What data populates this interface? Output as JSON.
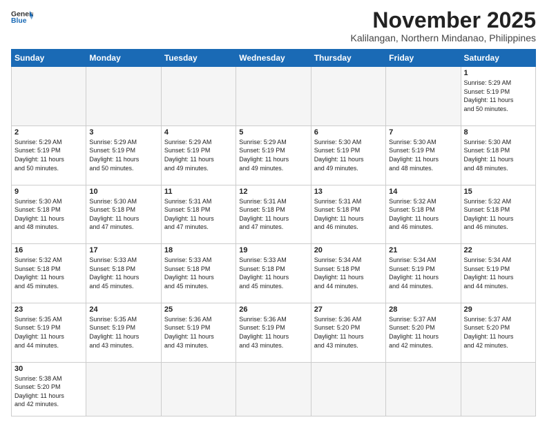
{
  "header": {
    "logo_line1": "General",
    "logo_line2": "Blue",
    "month": "November 2025",
    "location": "Kalilangan, Northern Mindanao, Philippines"
  },
  "days_of_week": [
    "Sunday",
    "Monday",
    "Tuesday",
    "Wednesday",
    "Thursday",
    "Friday",
    "Saturday"
  ],
  "weeks": [
    [
      {
        "num": "",
        "info": ""
      },
      {
        "num": "",
        "info": ""
      },
      {
        "num": "",
        "info": ""
      },
      {
        "num": "",
        "info": ""
      },
      {
        "num": "",
        "info": ""
      },
      {
        "num": "",
        "info": ""
      },
      {
        "num": "1",
        "info": "Sunrise: 5:29 AM\nSunset: 5:19 PM\nDaylight: 11 hours\nand 50 minutes."
      }
    ],
    [
      {
        "num": "2",
        "info": "Sunrise: 5:29 AM\nSunset: 5:19 PM\nDaylight: 11 hours\nand 50 minutes."
      },
      {
        "num": "3",
        "info": "Sunrise: 5:29 AM\nSunset: 5:19 PM\nDaylight: 11 hours\nand 50 minutes."
      },
      {
        "num": "4",
        "info": "Sunrise: 5:29 AM\nSunset: 5:19 PM\nDaylight: 11 hours\nand 49 minutes."
      },
      {
        "num": "5",
        "info": "Sunrise: 5:29 AM\nSunset: 5:19 PM\nDaylight: 11 hours\nand 49 minutes."
      },
      {
        "num": "6",
        "info": "Sunrise: 5:30 AM\nSunset: 5:19 PM\nDaylight: 11 hours\nand 49 minutes."
      },
      {
        "num": "7",
        "info": "Sunrise: 5:30 AM\nSunset: 5:19 PM\nDaylight: 11 hours\nand 48 minutes."
      },
      {
        "num": "8",
        "info": "Sunrise: 5:30 AM\nSunset: 5:18 PM\nDaylight: 11 hours\nand 48 minutes."
      }
    ],
    [
      {
        "num": "9",
        "info": "Sunrise: 5:30 AM\nSunset: 5:18 PM\nDaylight: 11 hours\nand 48 minutes."
      },
      {
        "num": "10",
        "info": "Sunrise: 5:30 AM\nSunset: 5:18 PM\nDaylight: 11 hours\nand 47 minutes."
      },
      {
        "num": "11",
        "info": "Sunrise: 5:31 AM\nSunset: 5:18 PM\nDaylight: 11 hours\nand 47 minutes."
      },
      {
        "num": "12",
        "info": "Sunrise: 5:31 AM\nSunset: 5:18 PM\nDaylight: 11 hours\nand 47 minutes."
      },
      {
        "num": "13",
        "info": "Sunrise: 5:31 AM\nSunset: 5:18 PM\nDaylight: 11 hours\nand 46 minutes."
      },
      {
        "num": "14",
        "info": "Sunrise: 5:32 AM\nSunset: 5:18 PM\nDaylight: 11 hours\nand 46 minutes."
      },
      {
        "num": "15",
        "info": "Sunrise: 5:32 AM\nSunset: 5:18 PM\nDaylight: 11 hours\nand 46 minutes."
      }
    ],
    [
      {
        "num": "16",
        "info": "Sunrise: 5:32 AM\nSunset: 5:18 PM\nDaylight: 11 hours\nand 45 minutes."
      },
      {
        "num": "17",
        "info": "Sunrise: 5:33 AM\nSunset: 5:18 PM\nDaylight: 11 hours\nand 45 minutes."
      },
      {
        "num": "18",
        "info": "Sunrise: 5:33 AM\nSunset: 5:18 PM\nDaylight: 11 hours\nand 45 minutes."
      },
      {
        "num": "19",
        "info": "Sunrise: 5:33 AM\nSunset: 5:18 PM\nDaylight: 11 hours\nand 45 minutes."
      },
      {
        "num": "20",
        "info": "Sunrise: 5:34 AM\nSunset: 5:18 PM\nDaylight: 11 hours\nand 44 minutes."
      },
      {
        "num": "21",
        "info": "Sunrise: 5:34 AM\nSunset: 5:19 PM\nDaylight: 11 hours\nand 44 minutes."
      },
      {
        "num": "22",
        "info": "Sunrise: 5:34 AM\nSunset: 5:19 PM\nDaylight: 11 hours\nand 44 minutes."
      }
    ],
    [
      {
        "num": "23",
        "info": "Sunrise: 5:35 AM\nSunset: 5:19 PM\nDaylight: 11 hours\nand 44 minutes."
      },
      {
        "num": "24",
        "info": "Sunrise: 5:35 AM\nSunset: 5:19 PM\nDaylight: 11 hours\nand 43 minutes."
      },
      {
        "num": "25",
        "info": "Sunrise: 5:36 AM\nSunset: 5:19 PM\nDaylight: 11 hours\nand 43 minutes."
      },
      {
        "num": "26",
        "info": "Sunrise: 5:36 AM\nSunset: 5:19 PM\nDaylight: 11 hours\nand 43 minutes."
      },
      {
        "num": "27",
        "info": "Sunrise: 5:36 AM\nSunset: 5:20 PM\nDaylight: 11 hours\nand 43 minutes."
      },
      {
        "num": "28",
        "info": "Sunrise: 5:37 AM\nSunset: 5:20 PM\nDaylight: 11 hours\nand 42 minutes."
      },
      {
        "num": "29",
        "info": "Sunrise: 5:37 AM\nSunset: 5:20 PM\nDaylight: 11 hours\nand 42 minutes."
      }
    ],
    [
      {
        "num": "30",
        "info": "Sunrise: 5:38 AM\nSunset: 5:20 PM\nDaylight: 11 hours\nand 42 minutes."
      },
      {
        "num": "",
        "info": ""
      },
      {
        "num": "",
        "info": ""
      },
      {
        "num": "",
        "info": ""
      },
      {
        "num": "",
        "info": ""
      },
      {
        "num": "",
        "info": ""
      },
      {
        "num": "",
        "info": ""
      }
    ]
  ]
}
